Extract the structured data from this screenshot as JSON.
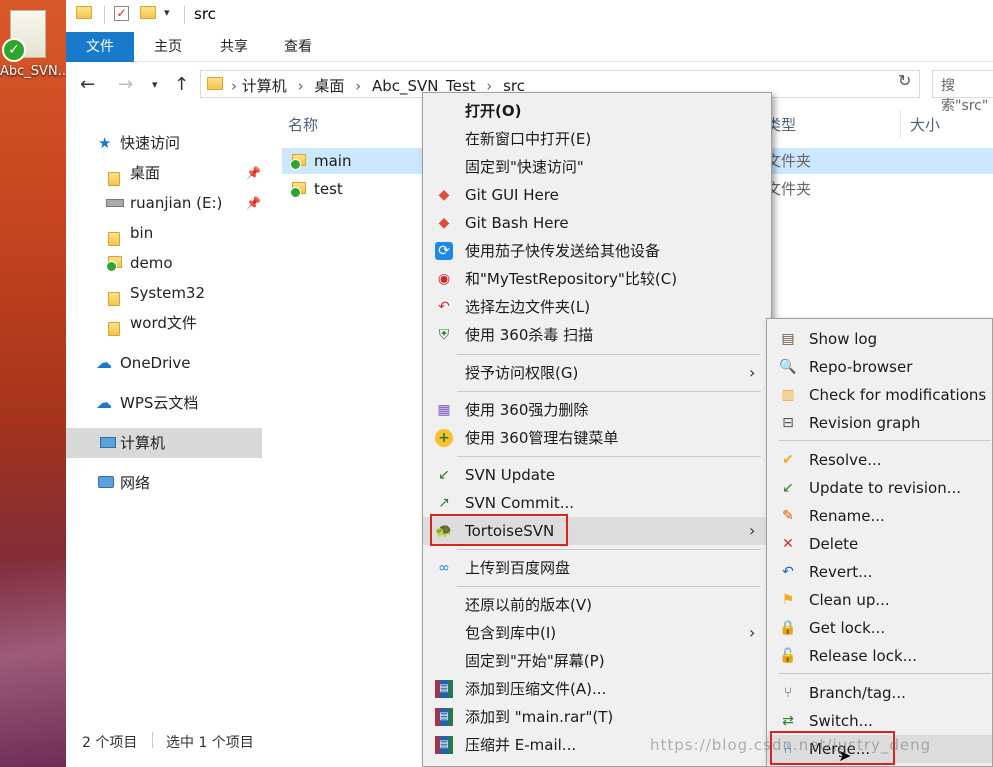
{
  "desktop": {
    "icon_label": "Abc_SVN..."
  },
  "titlebar": {
    "title": "src"
  },
  "ribbon": {
    "tabs": [
      "文件",
      "主页",
      "共享",
      "查看"
    ]
  },
  "address": {
    "crumbs": [
      "计算机",
      "桌面",
      "Abc_SVN_Test",
      "src"
    ],
    "search_placeholder": "搜索\"src\""
  },
  "navpane": {
    "items": [
      "快速访问",
      "桌面",
      "ruanjian (E:)",
      "bin",
      "demo",
      "System32",
      "word文件",
      "OneDrive",
      "WPS云文档",
      "计算机",
      "网络"
    ]
  },
  "content": {
    "columns": [
      "名称",
      "类型",
      "大小"
    ],
    "files": [
      {
        "name": "main",
        "type": "文件夹"
      },
      {
        "name": "test",
        "type": "文件夹"
      }
    ]
  },
  "status": {
    "count": "2 个项目",
    "selected": "选中 1 个项目"
  },
  "context_menu": {
    "items": [
      "打开(O)",
      "在新窗口中打开(E)",
      "固定到\"快速访问\"",
      "Git GUI Here",
      "Git Bash Here",
      "使用茄子快传发送给其他设备",
      "和\"MyTestRepository\"比较(C)",
      "选择左边文件夹(L)",
      "使用 360杀毒 扫描",
      "授予访问权限(G)",
      "使用 360强力删除",
      "使用 360管理右键菜单",
      "SVN Update",
      "SVN Commit...",
      "TortoiseSVN",
      "上传到百度网盘",
      "还原以前的版本(V)",
      "包含到库中(I)",
      "固定到\"开始\"屏幕(P)",
      "添加到压缩文件(A)...",
      "添加到 \"main.rar\"(T)",
      "压缩并 E-mail..."
    ]
  },
  "submenu": {
    "items": [
      "Show log",
      "Repo-browser",
      "Check for modifications",
      "Revision graph",
      "Resolve...",
      "Update to revision...",
      "Rename...",
      "Delete",
      "Revert...",
      "Clean up...",
      "Get lock...",
      "Release lock...",
      "Branch/tag...",
      "Switch...",
      "Merge..."
    ]
  },
  "watermark": "https://blog.csdn.net/justry_deng",
  "colors": {
    "accent": "#1979ca",
    "selection": "#cce8ff",
    "highlight_box": "#d9231f"
  }
}
